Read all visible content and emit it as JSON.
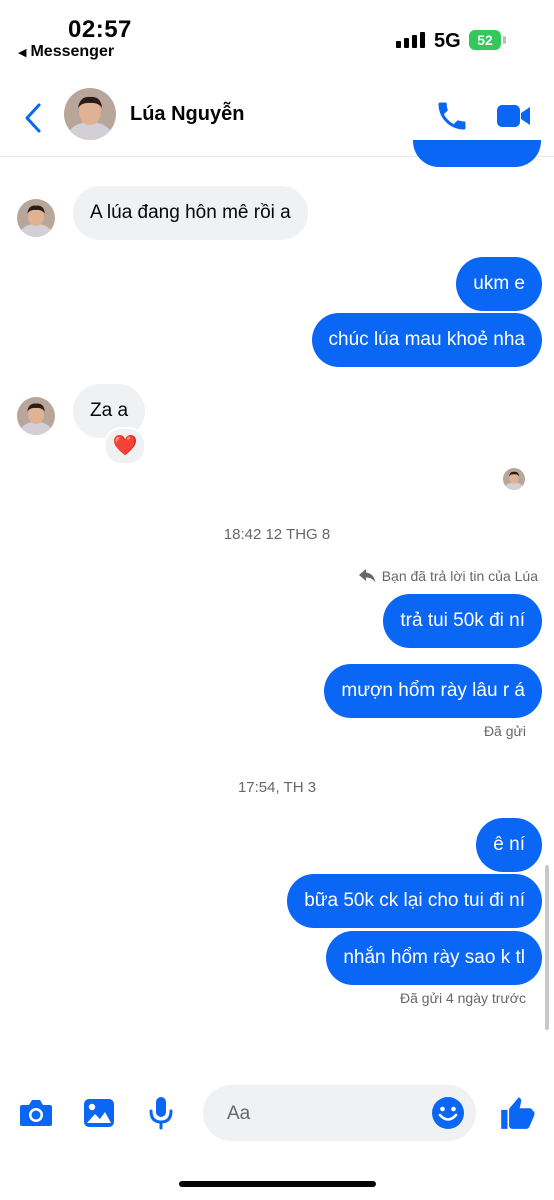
{
  "status_bar": {
    "time": "02:57",
    "back_app": "Messenger",
    "network": "5G",
    "battery": "52"
  },
  "header": {
    "contact_name": "Lúa Nguyễn"
  },
  "messages": {
    "m1": "A lúa đang hôn mê rồi  a",
    "m2": "ukm e",
    "m3": "chúc lúa mau khoẻ nha",
    "m4": "Za a",
    "m4_reaction": "❤️",
    "ts1": "18:42 12 THG 8",
    "reply_note": "Bạn đã trả lời tin của Lúa",
    "m5": "trả tui 50k đi ní",
    "m6": "mượn hổm rày lâu r á",
    "status1": "Đã gửi",
    "ts2": "17:54, TH 3",
    "m7": "ê ní",
    "m8": "bữa 50k ck lại cho tui đi ní",
    "m9": "nhắn hổm rày sao k tl",
    "status2": "Đã gửi 4 ngày trước"
  },
  "composer": {
    "placeholder": "Aa"
  },
  "colors": {
    "accent": "#0a66f5",
    "incoming_bubble": "#f0f1f3",
    "battery": "#34c759",
    "heart": "#e0232e"
  },
  "icons": {
    "back": "chevron-left-icon",
    "call": "phone-icon",
    "video": "video-camera-icon",
    "camera": "camera-icon",
    "gallery": "image-icon",
    "voice": "microphone-icon",
    "emoji": "smiley-icon",
    "like": "thumbs-up-icon"
  }
}
